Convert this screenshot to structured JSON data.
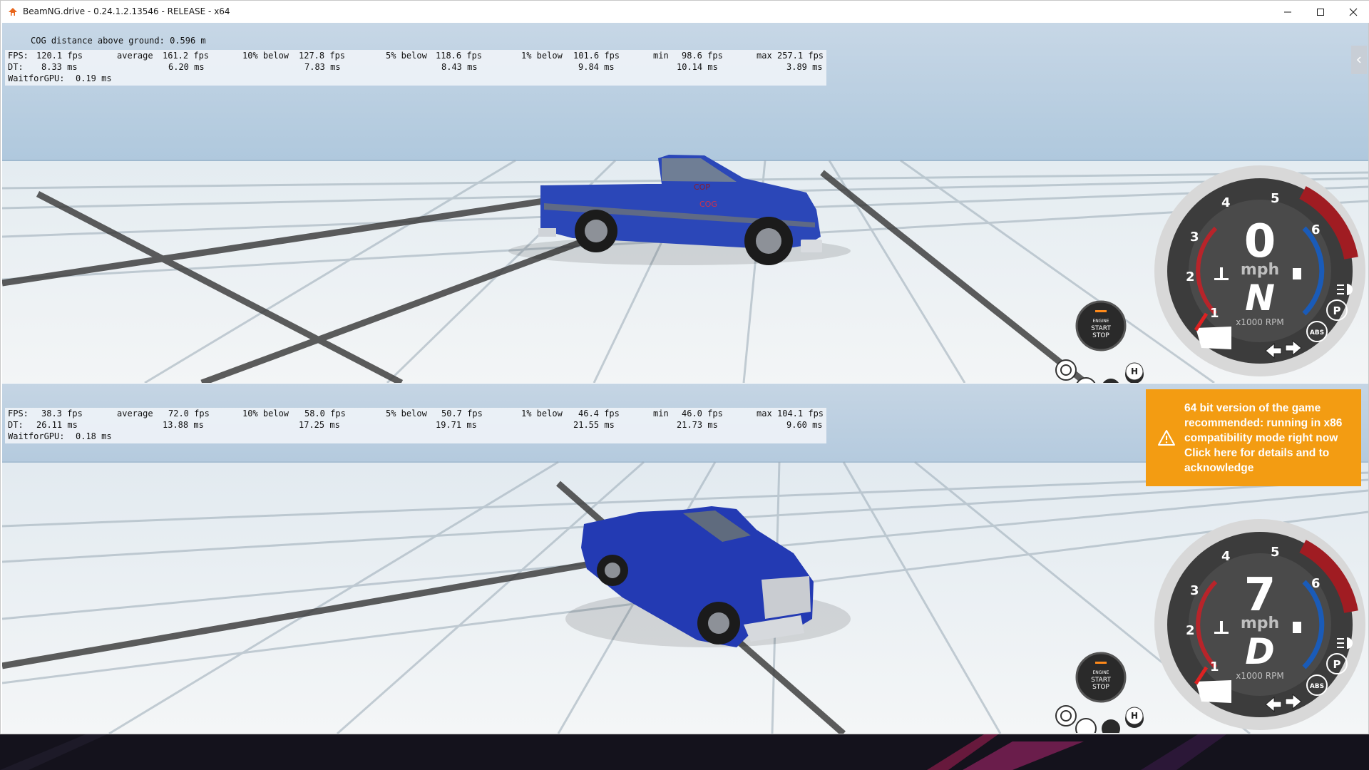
{
  "window": {
    "title": "BeamNG.drive - 0.24.1.2.13546 - RELEASE - x64",
    "minimize_icon": "minimize-icon",
    "maximize_icon": "maximize-icon",
    "close_icon": "close-icon"
  },
  "top_view": {
    "cog_text": "COG distance above ground: 0.596 m",
    "vehicle_labels": {
      "cop": "COP",
      "cog": "COG"
    },
    "stats": {
      "fps": "120.1 fps",
      "average": "161.2 fps",
      "p10": "127.8 fps",
      "p5": "118.6 fps",
      "p1": "101.6 fps",
      "min": "98.6 fps",
      "max": "257.1 fps",
      "dt": "8.33 ms",
      "dt_average": "6.20 ms",
      "dt_p10": "7.83 ms",
      "dt_p5": "8.43 ms",
      "dt_p1": "9.84 ms",
      "dt_min": "10.14 ms",
      "dt_max": "3.89 ms",
      "wait_gpu": "0.19 ms"
    },
    "dash": {
      "speed": "0",
      "unit": "mph",
      "gear": "N",
      "rpm_label": "x1000 RPM",
      "gauge_numbers": [
        "1",
        "2",
        "3",
        "4",
        "5",
        "6"
      ]
    }
  },
  "bottom_view": {
    "stats": {
      "fps": "38.3 fps",
      "average": "72.0 fps",
      "p10": "58.0 fps",
      "p5": "50.7 fps",
      "p1": "46.4 fps",
      "min": "46.0 fps",
      "max": "104.1 fps",
      "dt": "26.11 ms",
      "dt_average": "13.88 ms",
      "dt_p10": "17.25 ms",
      "dt_p5": "19.71 ms",
      "dt_p1": "21.55 ms",
      "dt_min": "21.73 ms",
      "dt_max": "9.60 ms",
      "wait_gpu": "0.18 ms"
    },
    "dash": {
      "speed": "7",
      "unit": "mph",
      "gear": "D",
      "rpm_label": "x1000 RPM",
      "gauge_numbers": [
        "1",
        "2",
        "3",
        "4",
        "5",
        "6"
      ]
    }
  },
  "labels": {
    "fps": "FPS:",
    "average": "average",
    "p10": "10% below",
    "p5": "5% below",
    "p1": "1% below",
    "min": "min",
    "max": "max",
    "dt": "DT:",
    "wait_gpu": "WaitforGPU:"
  },
  "engine_button": {
    "line1": "ENGINE",
    "line2": "START",
    "line3": "STOP"
  },
  "indicators": {
    "parking": "P",
    "abs": "ABS",
    "hazard": "H"
  },
  "notice": {
    "text": "64 bit version of the game recommended: running in x86 compatibility mode right now Click here for details and to acknowledge",
    "icon": "warning-icon"
  },
  "colors": {
    "notice": "#f39c12",
    "truck_blue": "#1f3aa8",
    "redline": "#a01c22",
    "fuel_blue": "#1a5bb8"
  }
}
